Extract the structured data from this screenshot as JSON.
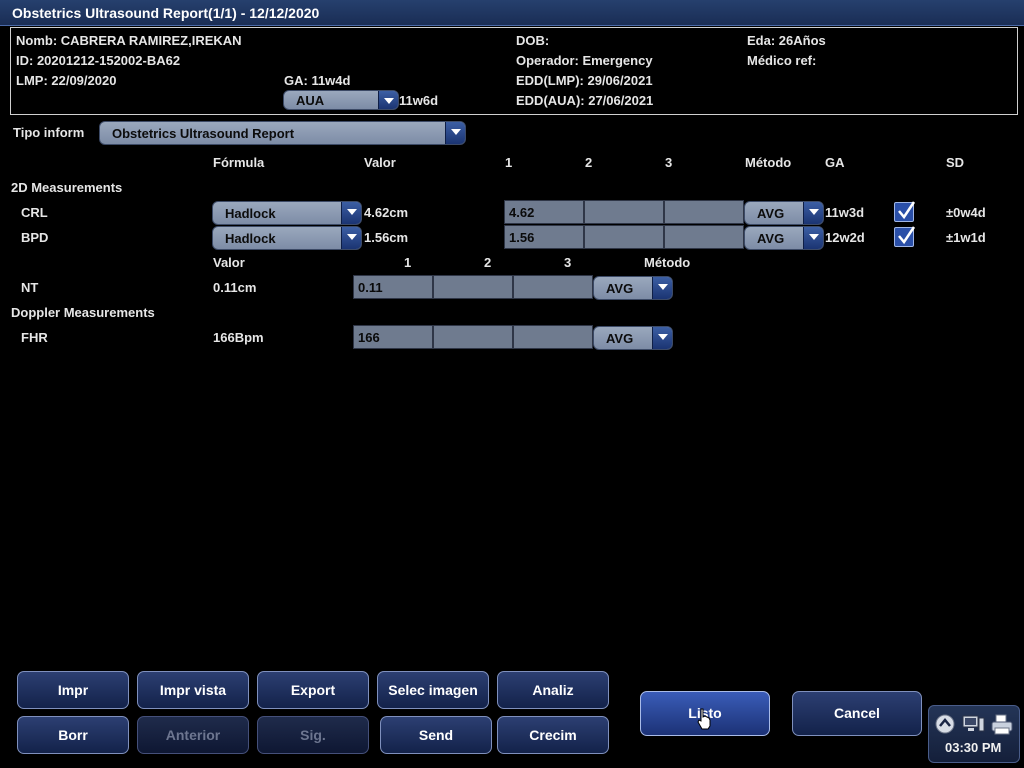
{
  "title": "Obstetrics Ultrasound Report(1/1) - 12/12/2020",
  "patient": {
    "name": "Nomb: CABRERA RAMIREZ,IREKAN",
    "id": "ID: 20201212-152002-BA62",
    "lmp": "LMP: 22/09/2020",
    "ga": "GA: 11w4d",
    "ga_method": "AUA",
    "ga_method_value": "11w6d",
    "dob": "DOB:",
    "operator": "Operador: Emergency",
    "edd_lmp": "EDD(LMP): 29/06/2021",
    "edd_aua": "EDD(AUA): 27/06/2021",
    "age": "Eda: 26Años",
    "ref_doctor": "Médico ref:"
  },
  "report_type": {
    "label": "Tipo inform",
    "value": "Obstetrics Ultrasound Report"
  },
  "headers_2d": {
    "formula": "Fórmula",
    "value": "Valor",
    "m1": "1",
    "m2": "2",
    "m3": "3",
    "method": "Método",
    "ga": "GA",
    "sd": "SD"
  },
  "sections": {
    "two_d": "2D Measurements",
    "doppler": "Doppler Measurements"
  },
  "rows_2d": [
    {
      "name": "CRL",
      "formula": "Hadlock",
      "value": "4.62cm",
      "m1": "4.62",
      "m2": "",
      "m3": "",
      "method": "AVG",
      "ga": "11w3d",
      "checked": true,
      "sd": "±0w4d"
    },
    {
      "name": "BPD",
      "formula": "Hadlock",
      "value": "1.56cm",
      "m1": "1.56",
      "m2": "",
      "m3": "",
      "method": "AVG",
      "ga": "12w2d",
      "checked": true,
      "sd": "±1w1d"
    }
  ],
  "headers_nt": {
    "value": "Valor",
    "m1": "1",
    "m2": "2",
    "m3": "3",
    "method": "Método"
  },
  "nt": {
    "name": "NT",
    "value": "0.11cm",
    "m1": "0.11",
    "m2": "",
    "m3": "",
    "method": "AVG"
  },
  "fhr": {
    "name": "FHR",
    "value": "166Bpm",
    "m1": "166",
    "m2": "",
    "m3": "",
    "method": "AVG"
  },
  "buttons": {
    "print": "Impr",
    "print_view": "Impr vista",
    "export": "Export",
    "select_image": "Selec imagen",
    "analyze": "Analiz",
    "delete": "Borr",
    "previous": "Anterior",
    "next": "Sig.",
    "send": "Send",
    "growth": "Crecim",
    "done": "Listo",
    "cancel": "Cancel"
  },
  "tray": {
    "time": "03:30 PM"
  },
  "icons": [
    "chevron-up-icon",
    "monitor-icon",
    "printer-icon",
    "check-icon",
    "dropdown-arrow-icon",
    "cursor-hand-icon"
  ],
  "colors": {
    "background": "#000000",
    "titlebar": "#1f3563",
    "button": "#1b2a55",
    "cell": "#6f7b8f"
  }
}
